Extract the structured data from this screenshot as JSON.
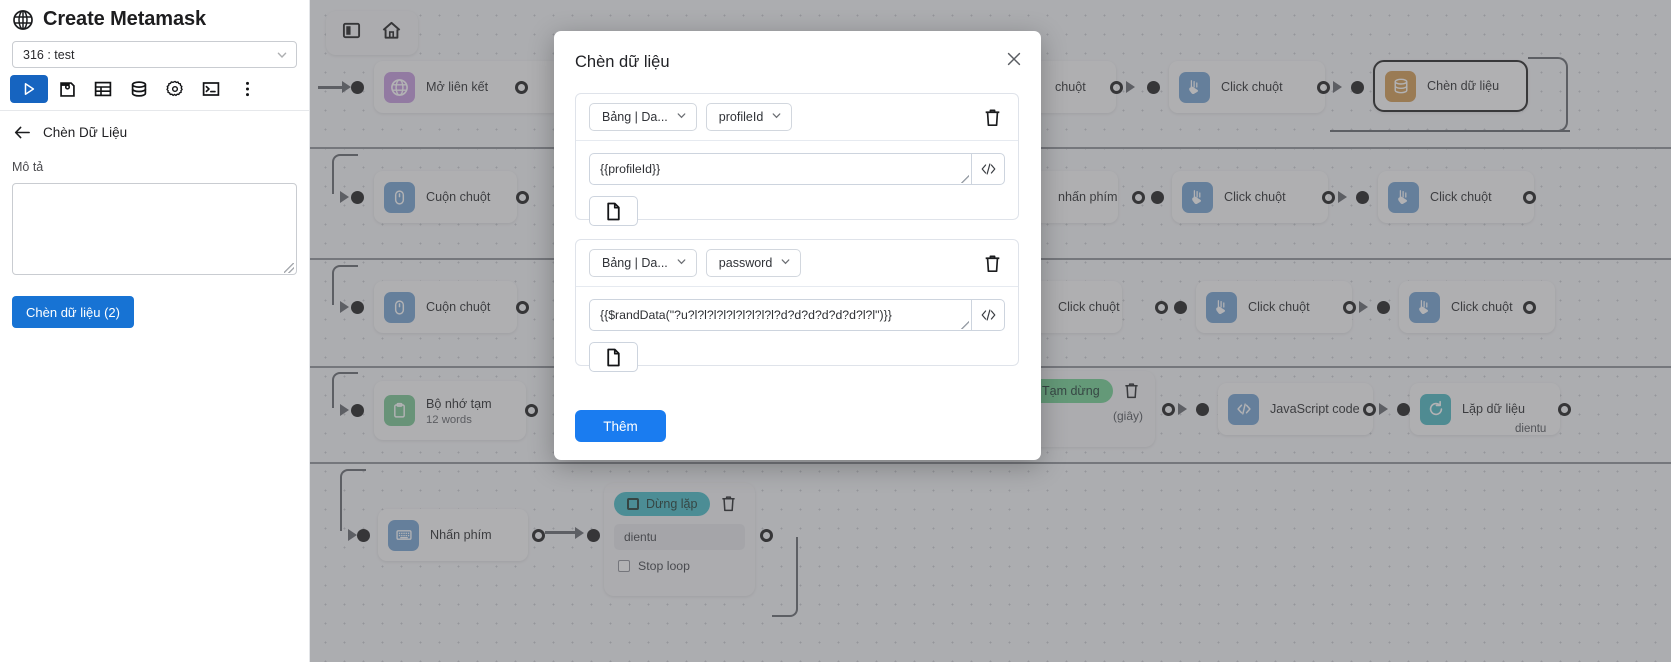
{
  "left_panel": {
    "app_title": "Create Metamask",
    "globe_icon": "globe-icon",
    "profile_select": {
      "value": "316 : test",
      "chevron": "chevron-down-icon"
    },
    "toolbar": [
      {
        "name": "run-button",
        "icon": "play-icon"
      },
      {
        "name": "save-button",
        "icon": "floppy-disk-icon"
      },
      {
        "name": "table-button",
        "icon": "table-icon"
      },
      {
        "name": "database-button",
        "icon": "database-icon"
      },
      {
        "name": "settings-button",
        "icon": "gear-icon"
      },
      {
        "name": "terminal-button",
        "icon": "terminal-icon"
      },
      {
        "name": "more-button",
        "icon": "kebab-menu-icon"
      }
    ],
    "back_label": "Chèn Dữ Liệu",
    "back_icon": "arrow-left-icon",
    "description_label": "Mô tả",
    "description_value": "",
    "insert_button": "Chèn dữ liệu (2)"
  },
  "modal": {
    "title": "Chèn dữ liệu",
    "close_icon": "close-icon",
    "add_button": "Thêm",
    "rows": [
      {
        "source_select": "Bảng | Da...",
        "field_select": "profileId",
        "value": "{{profileId}}",
        "code_icon": "code-brackets-icon",
        "file_icon": "file-icon",
        "trash_icon": "trash-icon",
        "chevron": "chevron-down-icon"
      },
      {
        "source_select": "Bảng | Da...",
        "field_select": "password",
        "value": "{{$randData(\"?u?l?l?l?l?l?l?l?l?l?d?d?d?d?d?d?l?l\")}}",
        "code_icon": "code-brackets-icon",
        "file_icon": "file-icon",
        "trash_icon": "trash-icon",
        "chevron": "chevron-down-icon"
      }
    ]
  },
  "canvas": {
    "home_bar": {
      "panel_icon": "sidebar-toggle-icon",
      "home_icon": "home-icon"
    },
    "nodes": [
      {
        "id": "n1",
        "label": "Mở liên kết",
        "sub": "",
        "icon": "globe-icon",
        "color": "purple",
        "selected": false
      },
      {
        "id": "n2",
        "label": "Cuộn chuột",
        "sub": "",
        "icon": "mouse-icon",
        "color": "blue",
        "selected": false
      },
      {
        "id": "n3",
        "label": "Cuộn chuột",
        "sub": "",
        "icon": "mouse-icon",
        "color": "blue",
        "selected": false
      },
      {
        "id": "n4",
        "label": "Bộ nhớ tạm",
        "sub": "12 words",
        "icon": "clipboard-icon",
        "color": "green",
        "selected": false
      },
      {
        "id": "n5",
        "label": "Nhấn phím",
        "sub": "",
        "icon": "keyboard-icon",
        "color": "blue",
        "selected": false
      },
      {
        "id": "n6",
        "label": "chuột",
        "sub": "",
        "icon": "mouse-icon",
        "color": "blue",
        "selected": false
      },
      {
        "id": "n7",
        "label": "Click chuột",
        "sub": "",
        "icon": "click-icon",
        "color": "blue",
        "selected": false
      },
      {
        "id": "n8",
        "label": "Chèn dữ liệu",
        "sub": "",
        "icon": "database-icon",
        "color": "orange",
        "selected": true
      },
      {
        "id": "n9",
        "label": "nhấn phím",
        "sub": "",
        "icon": "keyboard-icon",
        "color": "blue",
        "selected": false
      },
      {
        "id": "n10",
        "label": "Click chuột",
        "sub": "",
        "icon": "click-icon",
        "color": "blue",
        "selected": false
      },
      {
        "id": "n11",
        "label": "Click chuột",
        "sub": "",
        "icon": "click-icon",
        "color": "blue",
        "selected": false
      },
      {
        "id": "n12",
        "label": "Click chuột",
        "sub": "",
        "icon": "click-icon",
        "color": "blue",
        "selected": false
      },
      {
        "id": "n13",
        "label": "Click chuột",
        "sub": "",
        "icon": "click-icon",
        "color": "blue",
        "selected": false
      },
      {
        "id": "n14",
        "label": "Click chuột",
        "sub": "",
        "icon": "click-icon",
        "color": "blue",
        "selected": false
      },
      {
        "id": "n15",
        "label": "JavaScript code",
        "sub": "",
        "icon": "code-icon",
        "color": "blue",
        "selected": false
      },
      {
        "id": "n16",
        "label": "Lặp dữ liệu",
        "sub": "",
        "icon": "loop-icon",
        "color": "teal",
        "selected": false
      }
    ],
    "pause_node": {
      "pill_label": "Tạm dừng",
      "unit_label": "(giây)",
      "trash_icon": "trash-icon"
    },
    "loop_node": {
      "pill_label": "Dừng lặp",
      "field_value": "dientu",
      "checkbox_label": "Stop loop",
      "trash_icon": "trash-icon",
      "checkbox_icon": "checkbox-icon"
    },
    "side_label": "dientu"
  }
}
